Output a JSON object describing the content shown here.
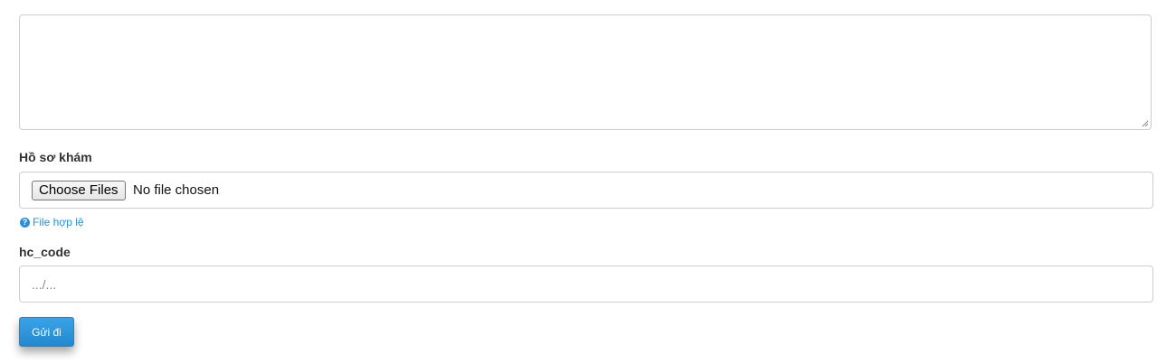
{
  "form": {
    "notes_textarea": {
      "value": ""
    },
    "health_record": {
      "label": "Hồ sơ khám",
      "choose_button_label": "Choose Files",
      "status_text": "No file chosen",
      "help_text": "File hợp lệ",
      "help_icon": "question-circle-icon"
    },
    "hc_code": {
      "label": "hc_code",
      "placeholder": ".../...",
      "value": ""
    },
    "submit_label": "Gửi đi"
  },
  "colors": {
    "accent": "#2289d0",
    "help_link": "#2a8fd6",
    "border": "#cccccc",
    "label_text": "#333333"
  }
}
